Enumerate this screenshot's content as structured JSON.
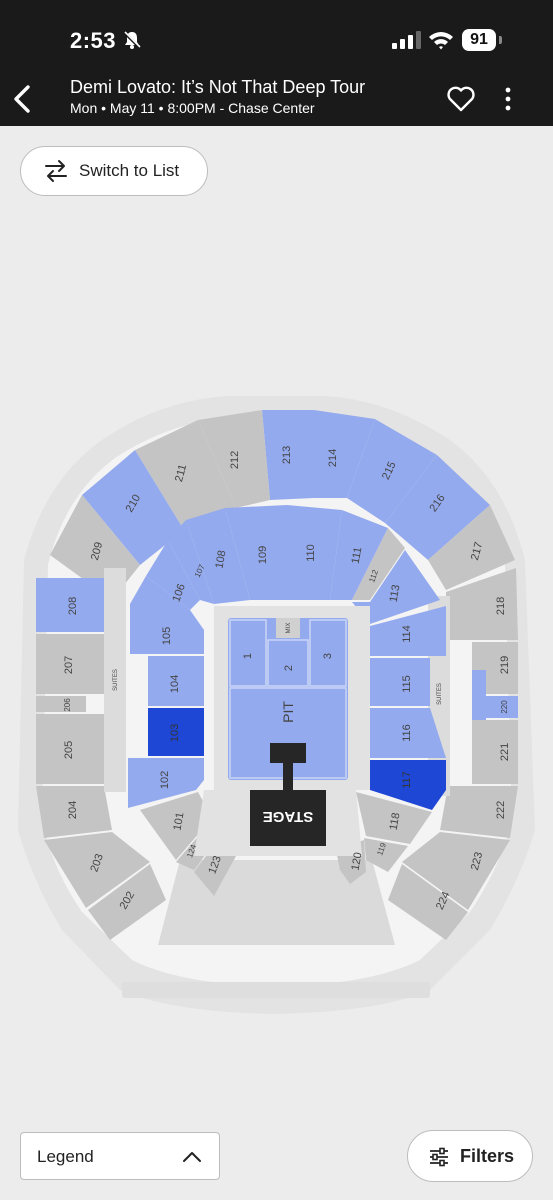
{
  "status_bar": {
    "time": "2:53",
    "battery": "91"
  },
  "header": {
    "title": "Demi Lovato: It’s Not That Deep Tour",
    "subtitle": "Mon • May 11 • 8:00PM - Chase Center"
  },
  "switch_button": {
    "label": "Switch to List"
  },
  "legend_button": {
    "label": "Legend"
  },
  "filters_button": {
    "label": "Filters"
  },
  "map": {
    "colors": {
      "available": "#94aaee",
      "unavailable": "#c4c4c4",
      "selected": "#1f47d6",
      "stage": "#262626",
      "floor": "#dcdcdc"
    },
    "labels": {
      "stage": "STAGE",
      "pit": "PIT",
      "mix": "MIX",
      "suites": "SUITES",
      "s1": "1",
      "s2": "2",
      "s3": "3",
      "s101": "101",
      "s102": "102",
      "s103": "103",
      "s104": "104",
      "s105": "105",
      "s106": "106",
      "s107": "107",
      "s108": "108",
      "s109": "109",
      "s110": "110",
      "s111": "111",
      "s112": "112",
      "s113": "113",
      "s114": "114",
      "s115": "115",
      "s116": "116",
      "s117": "117",
      "s118": "118",
      "s119": "119",
      "s120": "120",
      "s123": "123",
      "s124": "124",
      "s202": "202",
      "s203": "203",
      "s204": "204",
      "s205": "205",
      "s206": "206",
      "s207": "207",
      "s208": "208",
      "s209": "209",
      "s210": "210",
      "s211": "211",
      "s212": "212",
      "s213": "213",
      "s214": "214",
      "s215": "215",
      "s216": "216",
      "s217": "217",
      "s218": "218",
      "s219": "219",
      "s220": "220",
      "s221": "221",
      "s222": "222",
      "s223": "223",
      "s224": "224"
    }
  }
}
